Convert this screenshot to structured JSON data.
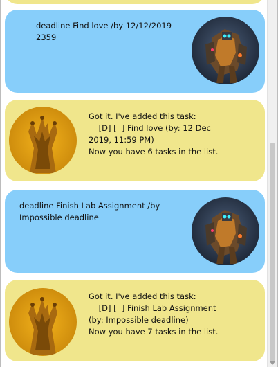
{
  "messages": [
    {
      "role": "user",
      "text": "deadline Find love /by 12/12/2019 2359",
      "avatar": "robot-avatar-icon"
    },
    {
      "role": "bot",
      "text": "Got it. I've added this task:\n    [D] [  ] Find love (by: 12 Dec 2019, 11:59 PM)\nNow you have 6 tasks in the list.",
      "avatar": "monster-avatar-icon"
    },
    {
      "role": "user",
      "text": "deadline Finish Lab Assignment /by Impossible deadline",
      "avatar": "robot-avatar-icon"
    },
    {
      "role": "bot",
      "text": "Got it. I've added this task:\n    [D] [  ] Finish Lab Assignment (by: Impossible deadline)\nNow you have 7 tasks in the list.",
      "avatar": "monster-avatar-icon"
    }
  ],
  "colors": {
    "user_bubble": "#87cefa",
    "bot_bubble": "#f0e68c"
  }
}
